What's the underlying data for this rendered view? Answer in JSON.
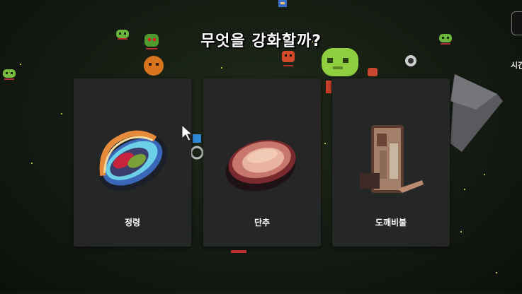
{
  "prompt": {
    "title": "무엇을 강화할까?"
  },
  "hud": {
    "partial_text": "시간"
  },
  "choices": [
    {
      "label": "정령",
      "icon": "spirit-orb-icon"
    },
    {
      "label": "단추",
      "icon": "button-icon"
    },
    {
      "label": "도깨비불",
      "icon": "dokkaebi-fire-icon"
    }
  ],
  "colors": {
    "card": "#262628",
    "title": "#ffffff",
    "ground": "#141b12"
  }
}
